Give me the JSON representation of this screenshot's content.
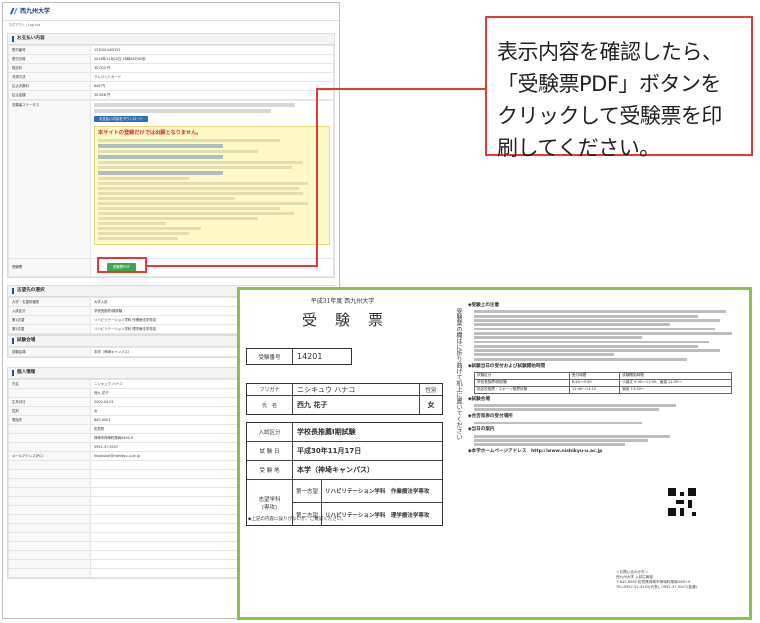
{
  "callout": {
    "text": "表示内容を確認したら、\n「受験票PDF」ボタンを\nクリックして受験票を印\n刷してください。"
  },
  "site": {
    "name": "西九州大学",
    "breadcrumb": "ログアウト  |  Log out"
  },
  "webpage": {
    "section1_title": "お支払い内容",
    "section1_rows": [
      {
        "k": "受付番号",
        "v": "1230014#5151"
      },
      {
        "k": "受付日時",
        "v": "2018年11月12日 18時04分00秒"
      },
      {
        "k": "検定料",
        "v": "30,000 円"
      },
      {
        "k": "決済方法",
        "v": "クレジットカード"
      },
      {
        "k": "払込手数料",
        "v": "648 円"
      },
      {
        "k": "払込金額",
        "v": "30,648 円"
      }
    ],
    "status_label": "志願者ステータス",
    "pay_button": "お支払い内容をダウンロード",
    "notice_warning": "本サイトの登録だけでは出願となりません。",
    "ticket_label": "受験票",
    "ticket_button": "受験票PDF",
    "section2_title": "志望先の選択",
    "section2_rows": [
      {
        "k": "大学・志望校種別",
        "v": "大学入試"
      },
      {
        "k": "入試区分",
        "v": "学校長推薦I期試験"
      },
      {
        "k": "第1志望",
        "v": "リハビリテーション学科 作業療法学専攻"
      },
      {
        "k": "第2志望",
        "v": "リハビリテーション学科 理学療法学専攻"
      }
    ],
    "section3_title": "試験会場",
    "section3_rows": [
      {
        "k": "試験会場",
        "v": "本学（神埼キャンパス）"
      }
    ],
    "section4_title": "個人情報",
    "section4_rows": [
      {
        "k": "氏名",
        "v": "ニシキュウ ハナコ"
      },
      {
        "k": "",
        "v": "西九 花子"
      },
      {
        "k": "生年月日",
        "v": "2000-04-01"
      },
      {
        "k": "性別",
        "v": "女"
      },
      {
        "k": "電話先",
        "v": "840-0001"
      },
      {
        "k": "",
        "v": "佐賀県"
      },
      {
        "k": "",
        "v": "神埼市神埼町尾崎4490-9"
      },
      {
        "k": "",
        "v": "0952-37-9207"
      },
      {
        "k": "メールアドレス(PC)",
        "v": "hinakukai@nishikyu-u.ac.jp"
      },
      {
        "k": "",
        "v": ""
      },
      {
        "k": "",
        "v": ""
      },
      {
        "k": "",
        "v": ""
      },
      {
        "k": "",
        "v": ""
      },
      {
        "k": "",
        "v": ""
      },
      {
        "k": "",
        "v": ""
      },
      {
        "k": "",
        "v": ""
      },
      {
        "k": "",
        "v": ""
      },
      {
        "k": "",
        "v": ""
      },
      {
        "k": "",
        "v": ""
      },
      {
        "k": "",
        "v": ""
      },
      {
        "k": "",
        "v": ""
      },
      {
        "k": "",
        "v": ""
      }
    ]
  },
  "ticket": {
    "university": "平成31年度 西九州大学",
    "title": "受験票",
    "exam_no_label": "受験番号",
    "exam_no": "14201",
    "furigana_label": "フリガナ",
    "furigana": "ニシキュウ ハナコ",
    "gender_label": "性別",
    "name_label": "氏　名",
    "name": "西九 花子",
    "gender": "女",
    "category_label": "入試区分",
    "category": "学校長推薦I期試験",
    "date_label": "試 験 日",
    "date": "平成30年11月17日",
    "venue_label": "受 験 地",
    "venue": "本学（神埼キャンパス）",
    "pref_label": "志望学科\n(専攻)",
    "pref1_label": "第一志望",
    "pref1": "リハビリテーション学科　作業療法学専攻",
    "pref2_label": "第二志望",
    "pref2": "リハビリテーション学科　理学療法学専攻",
    "note": "◆上記の内容に誤りがないか、ご確認ください。",
    "fold_text": "受験票の欄はに折り曲げて机上に置いてください"
  },
  "guide": {
    "h1": "◆受験上の注意",
    "h2": "◆試験当日の受付および試験開始時間",
    "h3": "◆試験会場",
    "h4": "◆合否発表の受付場所",
    "h5": "◆当日の案内",
    "h6": "◆本学ホームページアドレス　http://www.nishikyu-u.ac.jp",
    "table_header": [
      "試験区分",
      "受付時間",
      "試験開始時間"
    ],
    "table_rows": [
      [
        "学校長推薦I期試験",
        "8:40～9:30",
        "小論文 9:30～11:00、面接 11:20～"
      ],
      [
        "指定校推薦・スポーツ推薦試験",
        "12:40～13:10",
        "面接 13:30～"
      ]
    ],
    "contact": "＜お問い合わせ先＞\n西九州大学 入試広報部\n〒842-8585 佐賀県神埼市神埼町尾崎4490-9\nTEL:0952-52-4191(代表), 0952-37-9207(直通)"
  }
}
